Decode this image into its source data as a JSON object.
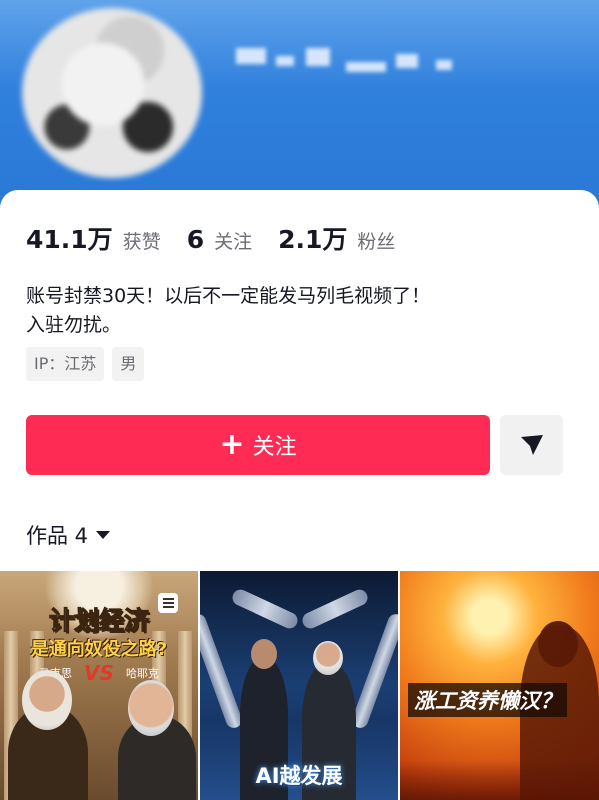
{
  "stats": [
    {
      "num": "41.1万",
      "label": "获赞"
    },
    {
      "num": "6",
      "label": "关注"
    },
    {
      "num": "2.1万",
      "label": "粉丝"
    }
  ],
  "bio": {
    "line1": "账号封禁30天！以后不一定能发马列毛视频了！",
    "line2": "入驻勿扰。"
  },
  "tags": [
    "IP：江苏",
    "男"
  ],
  "follow_button": {
    "icon": "plus-icon",
    "label": "关注"
  },
  "more_button": {
    "icon": "send-icon"
  },
  "works": {
    "label": "作品 4",
    "icon": "caret-down-icon"
  },
  "thumbnails": [
    {
      "title_line1": "计划经济",
      "title_line2": "是通向奴役之路?",
      "left_name": "马克思",
      "vs": "VS",
      "right_name": "哈耶克",
      "badge_icon": "document-icon"
    },
    {
      "caption": "AI越发展"
    },
    {
      "caption": "涨工资养懒汉？"
    }
  ],
  "colors": {
    "accent": "#fe2c55",
    "banner": "#2f7fdc",
    "muted_text": "#6d6e75"
  }
}
